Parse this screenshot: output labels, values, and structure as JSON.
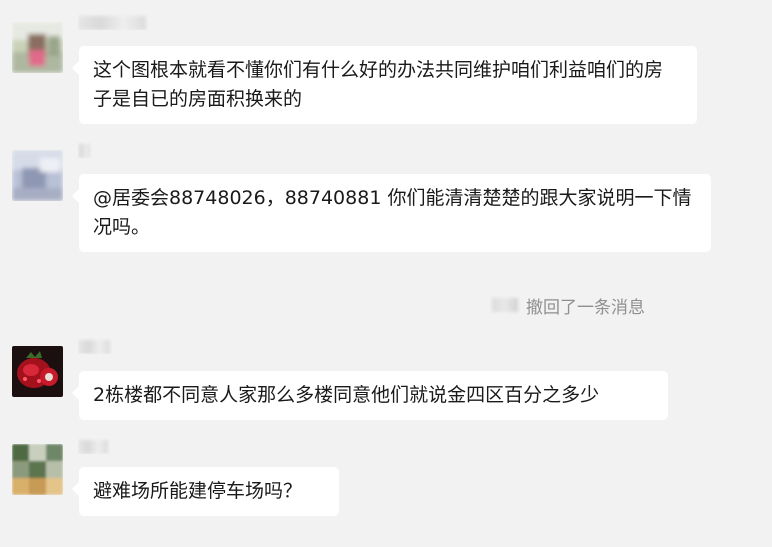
{
  "messages": [
    {
      "sender": "",
      "text": "这个图根本就看不懂你们有什么好的办法共同维护咱们利益咱们的房子是自已的房面积换来的",
      "avatar_icon": "photo-avatar-icon"
    },
    {
      "sender": "",
      "text": "@居委会88748026，88740881 你们能清清楚楚的跟大家说明一下情况吗。",
      "avatar_icon": "photo-avatar-icon"
    },
    {
      "sender": "",
      "text": "2栋楼都不同意人家那么多楼同意他们就说金四区百分之多少",
      "avatar_icon": "pomegranate-avatar-icon"
    },
    {
      "sender": "",
      "text": "避难场所能建停车场吗？",
      "avatar_icon": "photo-avatar-icon"
    }
  ],
  "system_notice": {
    "text": "撤回了一条消息"
  },
  "colors": {
    "background": "#f2f2f2",
    "bubble": "#ffffff",
    "text": "#1a1a1a",
    "system_text": "#8f8f8f"
  }
}
